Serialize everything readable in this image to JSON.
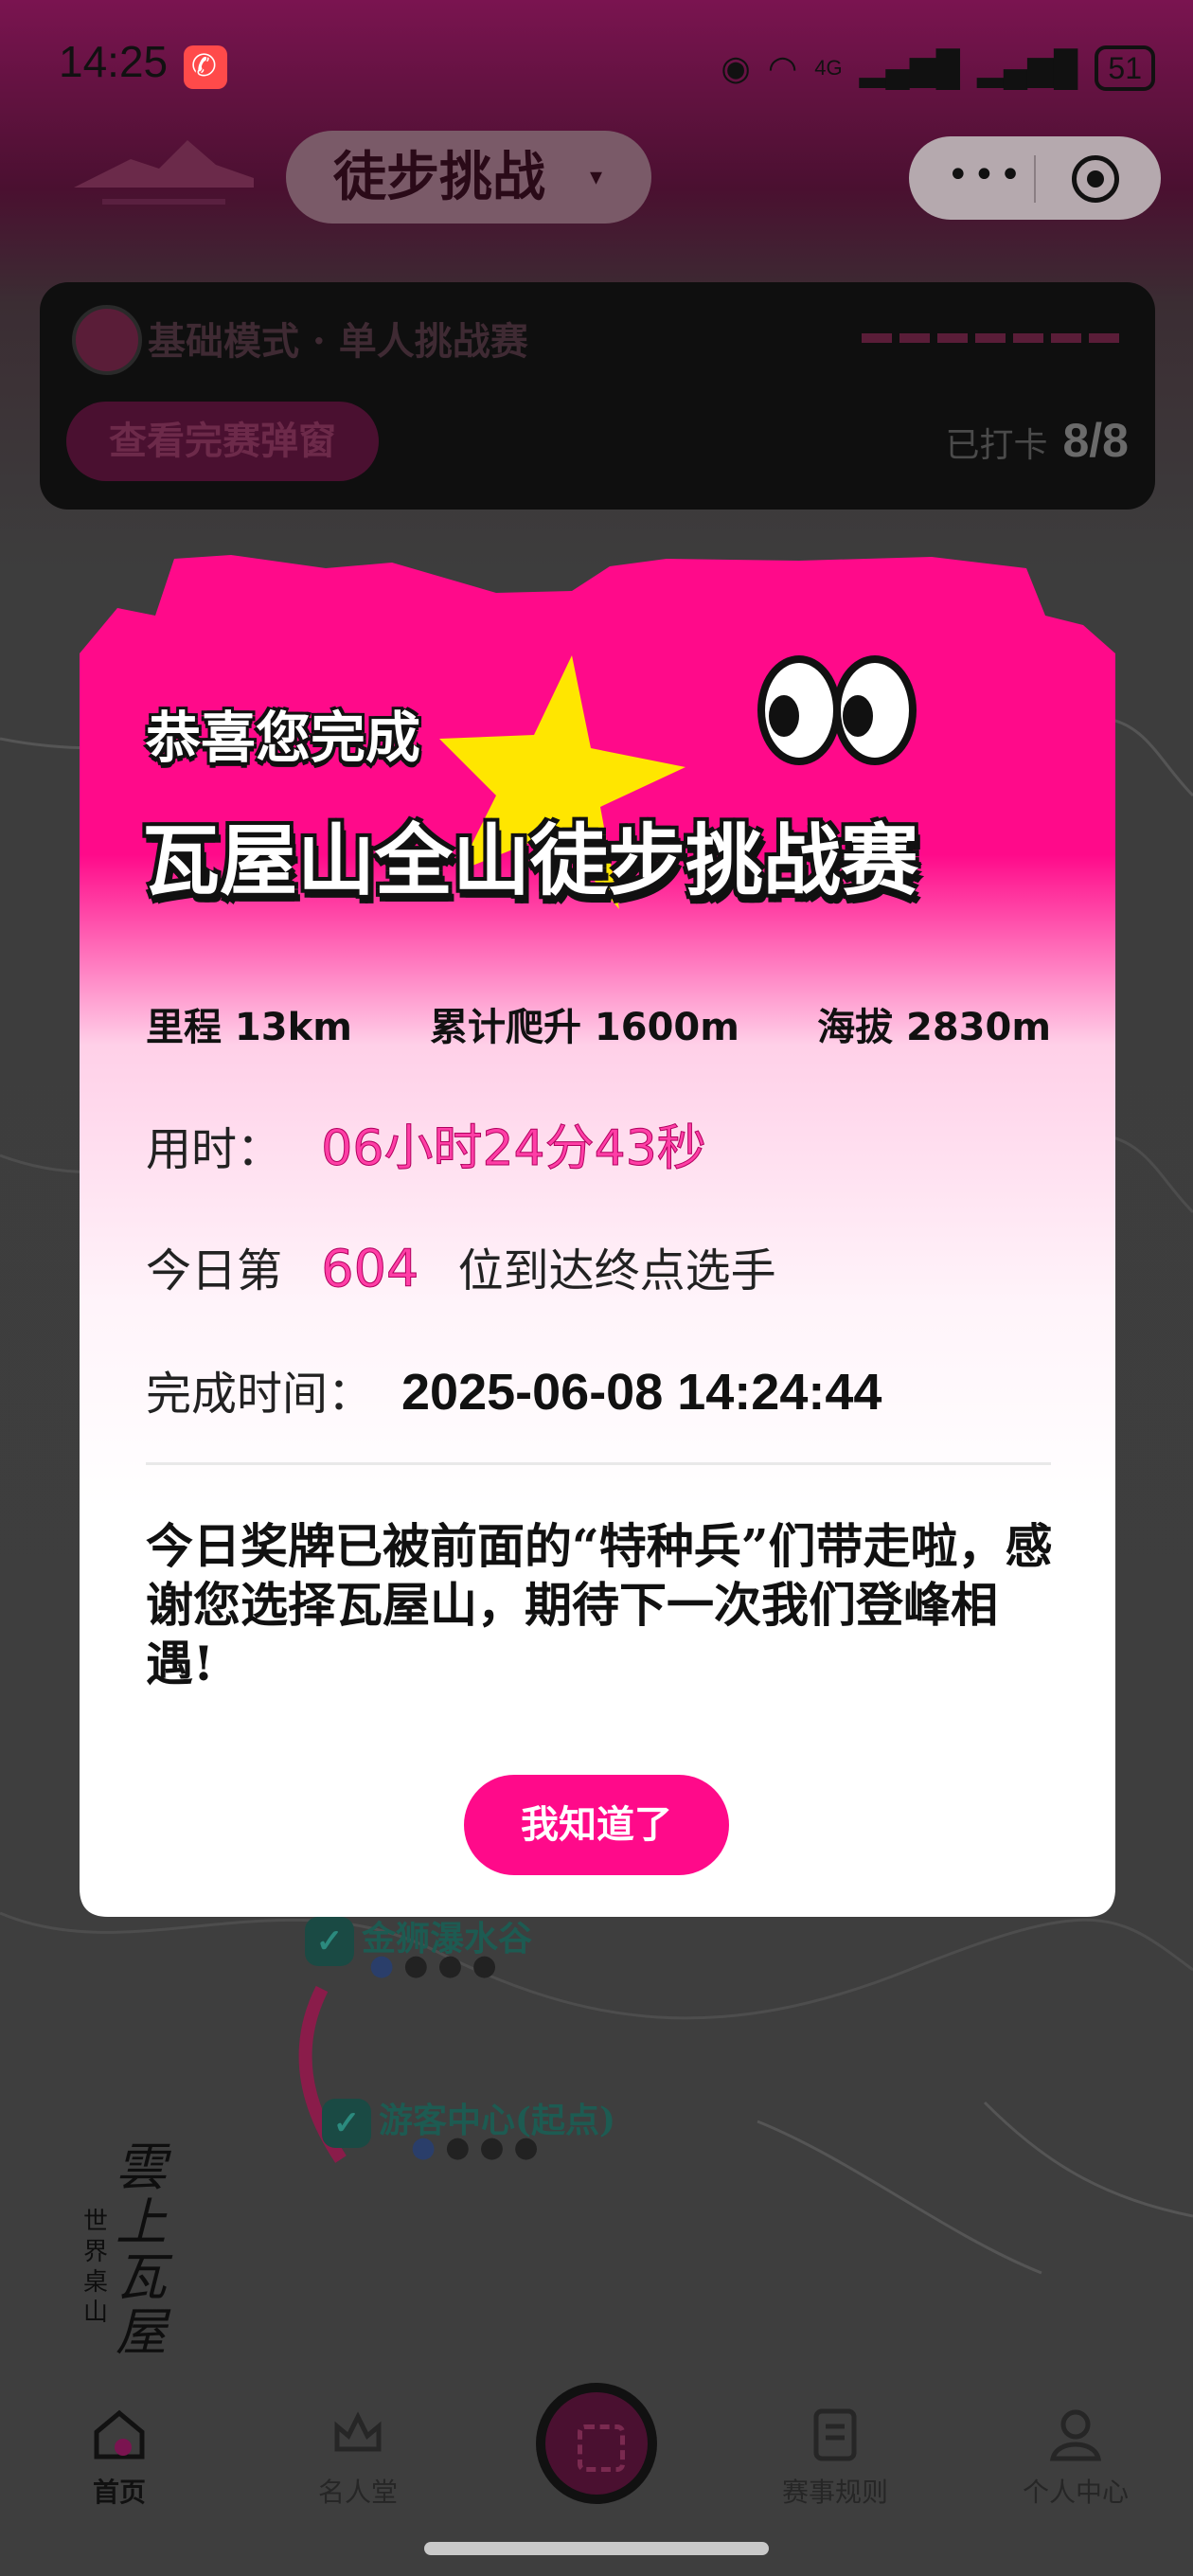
{
  "status_bar": {
    "time": "14:25",
    "battery": "51",
    "network": "4G"
  },
  "header": {
    "title": "徒步挑战",
    "caret": "▾",
    "more_icon": "•••",
    "target_icon": "record-icon"
  },
  "mode_card": {
    "mode_label": "基础模式 · 单人挑战赛",
    "view_button": "查看完赛弹窗",
    "checked_label": "已打卡",
    "checked_value": "8/8"
  },
  "map": {
    "points": [
      {
        "name": "金狮瀑水谷"
      },
      {
        "name": "游客中心(起点)"
      }
    ]
  },
  "brand": {
    "left_text": "世界桌山",
    "right_text": "雲上瓦屋"
  },
  "modal": {
    "subtitle": "恭喜您完成",
    "title": "瓦屋山全山徒步挑战赛",
    "stats": [
      {
        "label": "里程 13km"
      },
      {
        "label": "累计爬升 1600m"
      },
      {
        "label": "海拔 2830m"
      }
    ],
    "duration_label": "用时：",
    "duration_value": "06小时24分43秒",
    "rank_prefix": "今日第",
    "rank_value": "604",
    "rank_suffix": "位到达终点选手",
    "finish_label": "完成时间：",
    "finish_value": "2025-06-08 14:24:44",
    "message": "今日奖牌已被前面的“特种兵”们带走啦，感谢您选择瓦屋山，期待下一次我们登峰相遇!",
    "ok_button": "我知道了",
    "colors": {
      "accent": "#ff0a8a",
      "highlight": "#ff3ea6",
      "star": "#ffe600"
    }
  },
  "tabbar": {
    "tabs": [
      {
        "label": "首页",
        "icon": "home-icon"
      },
      {
        "label": "名人堂",
        "icon": "crown-icon"
      },
      {
        "label": "scan",
        "icon": "scan-icon"
      },
      {
        "label": "赛事规则",
        "icon": "document-icon"
      },
      {
        "label": "个人中心",
        "icon": "person-icon"
      }
    ]
  }
}
